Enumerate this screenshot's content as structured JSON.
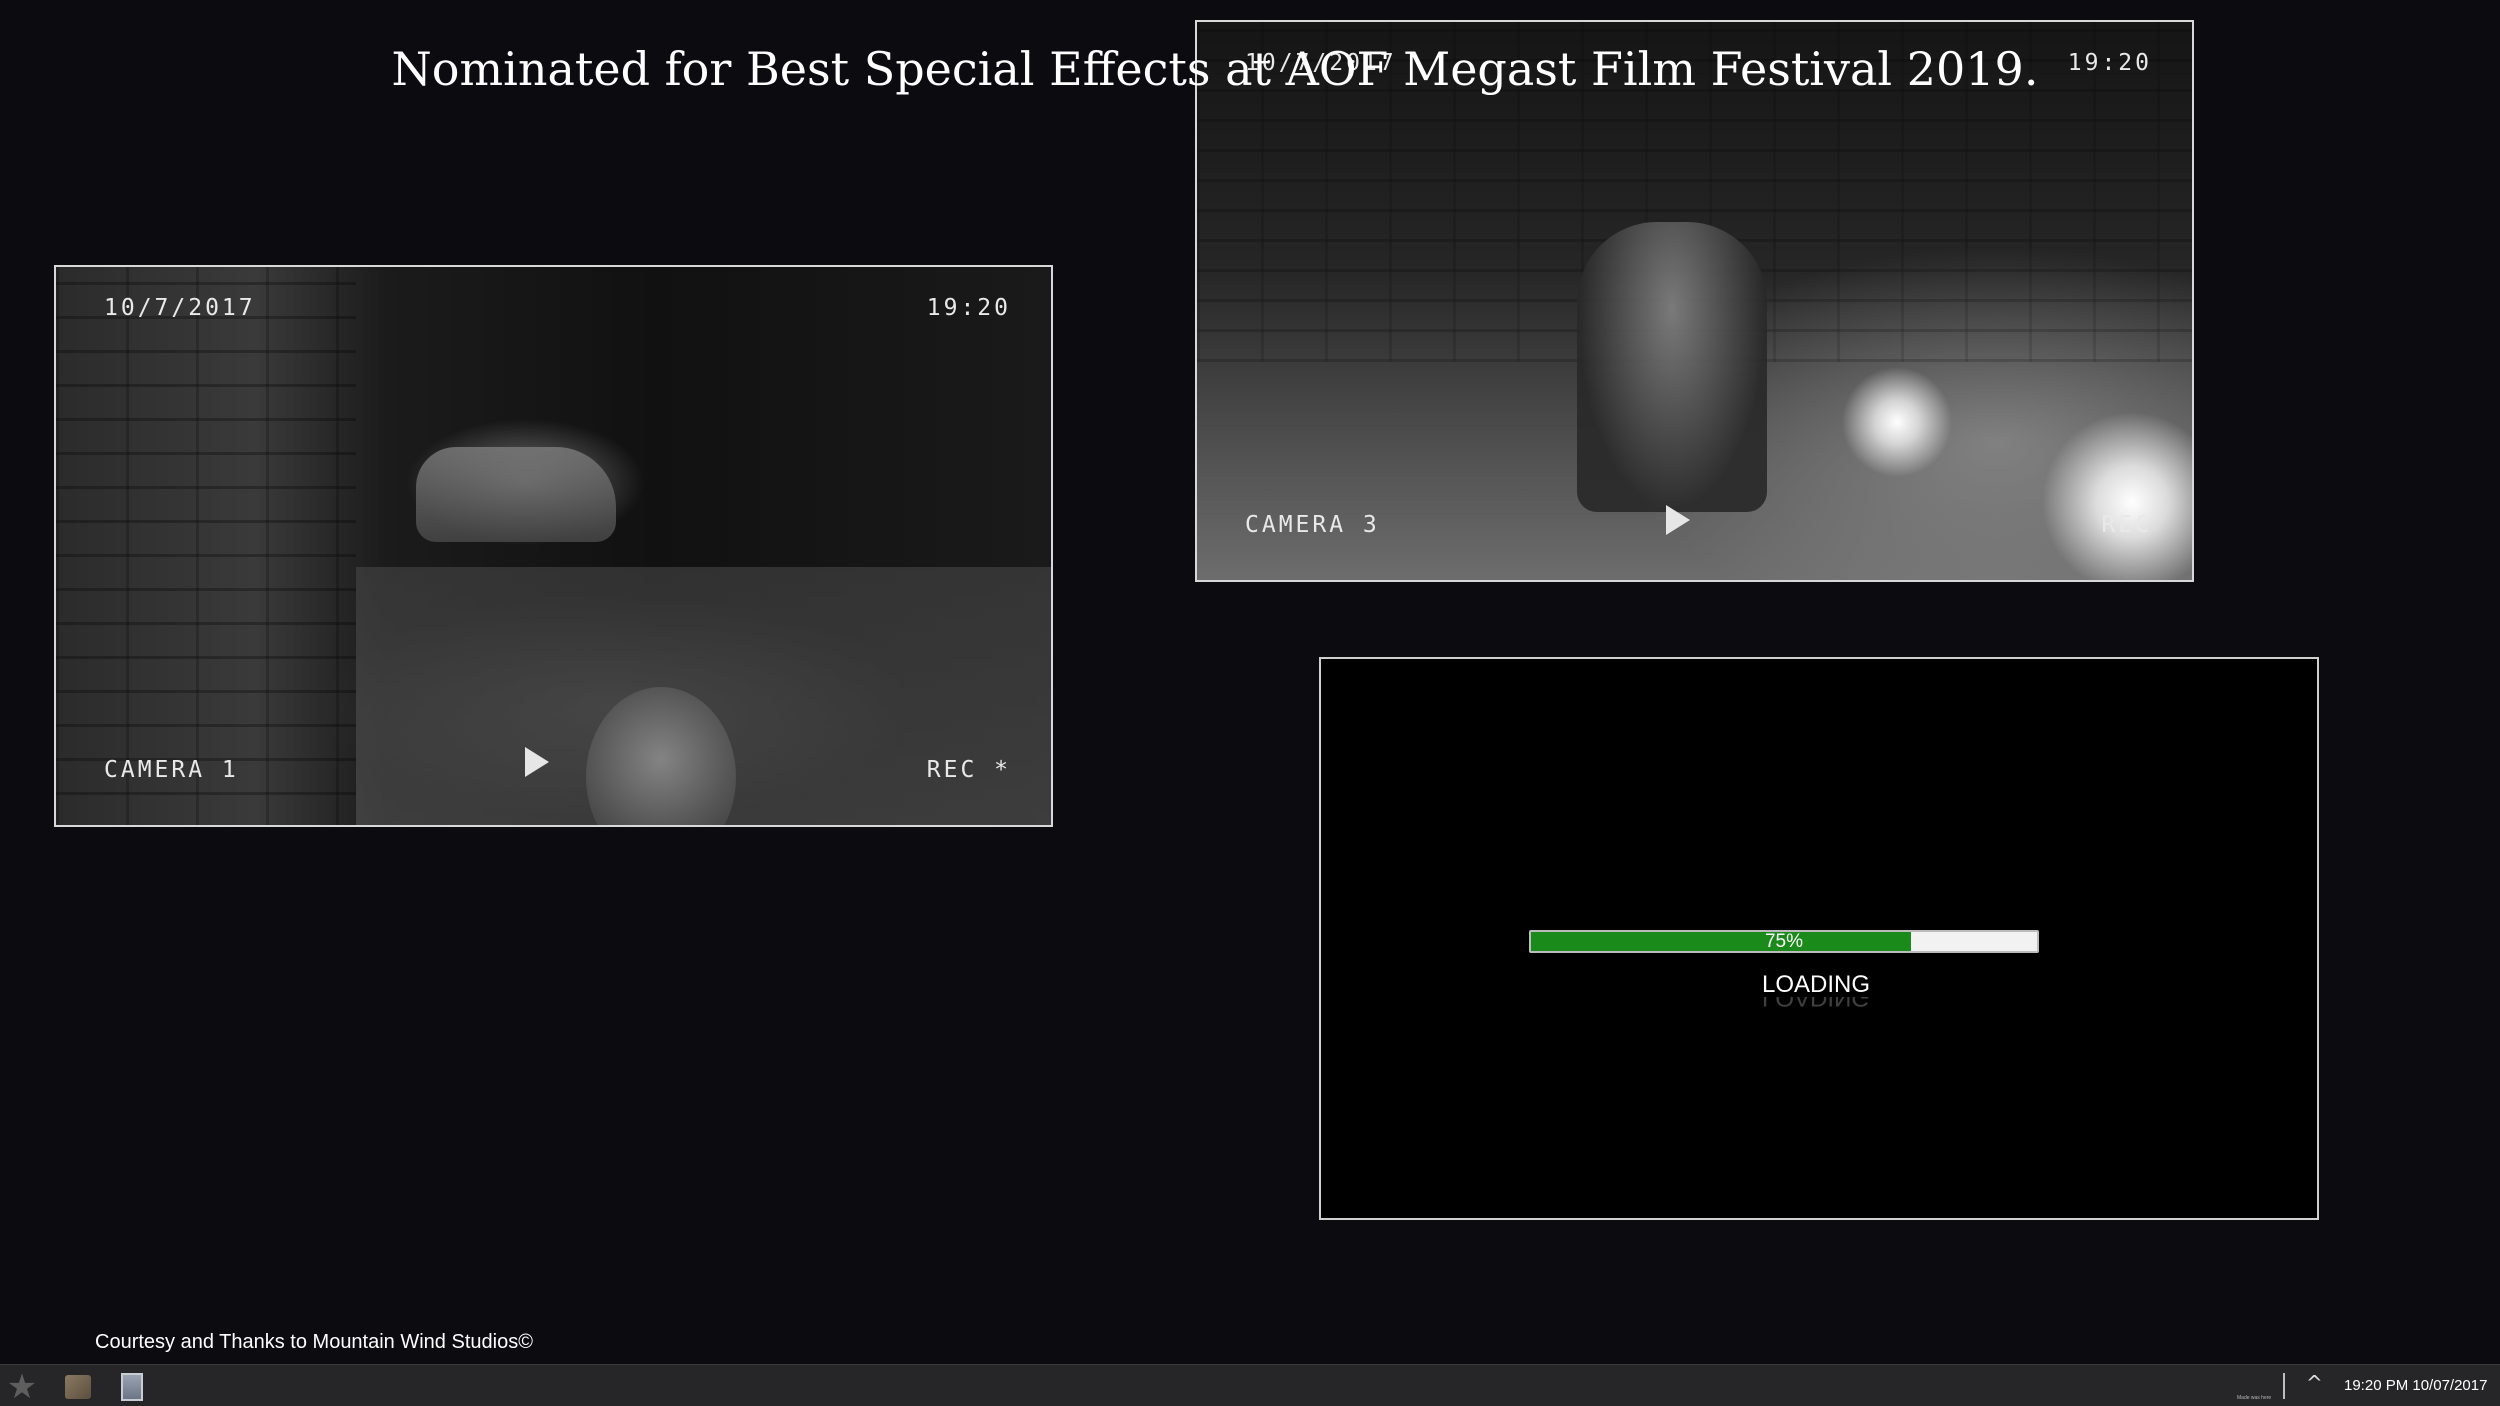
{
  "headline": "Nominated for Best Special Effects at AOF Megast Film Festival 2019.",
  "cameras": [
    {
      "date": "10/7/2017",
      "time": "19:20",
      "label": "CAMERA 1",
      "status": "REC *"
    },
    {
      "date": "10/7/2017",
      "time": "19:20",
      "label": "CAMERA 3",
      "status": "REC"
    }
  ],
  "loading": {
    "percent_text": "75%",
    "progress_fraction": 0.75,
    "label": "LOADING",
    "bar_color": "#1a8a1a"
  },
  "credit": "Courtesy and Thanks to Mountain Wind Studios©",
  "taskbar": {
    "icons": [
      "star-icon",
      "package-icon",
      "document-icon"
    ],
    "tray_note": "Made was here",
    "clock": "19:20 PM 10/07/2017"
  }
}
